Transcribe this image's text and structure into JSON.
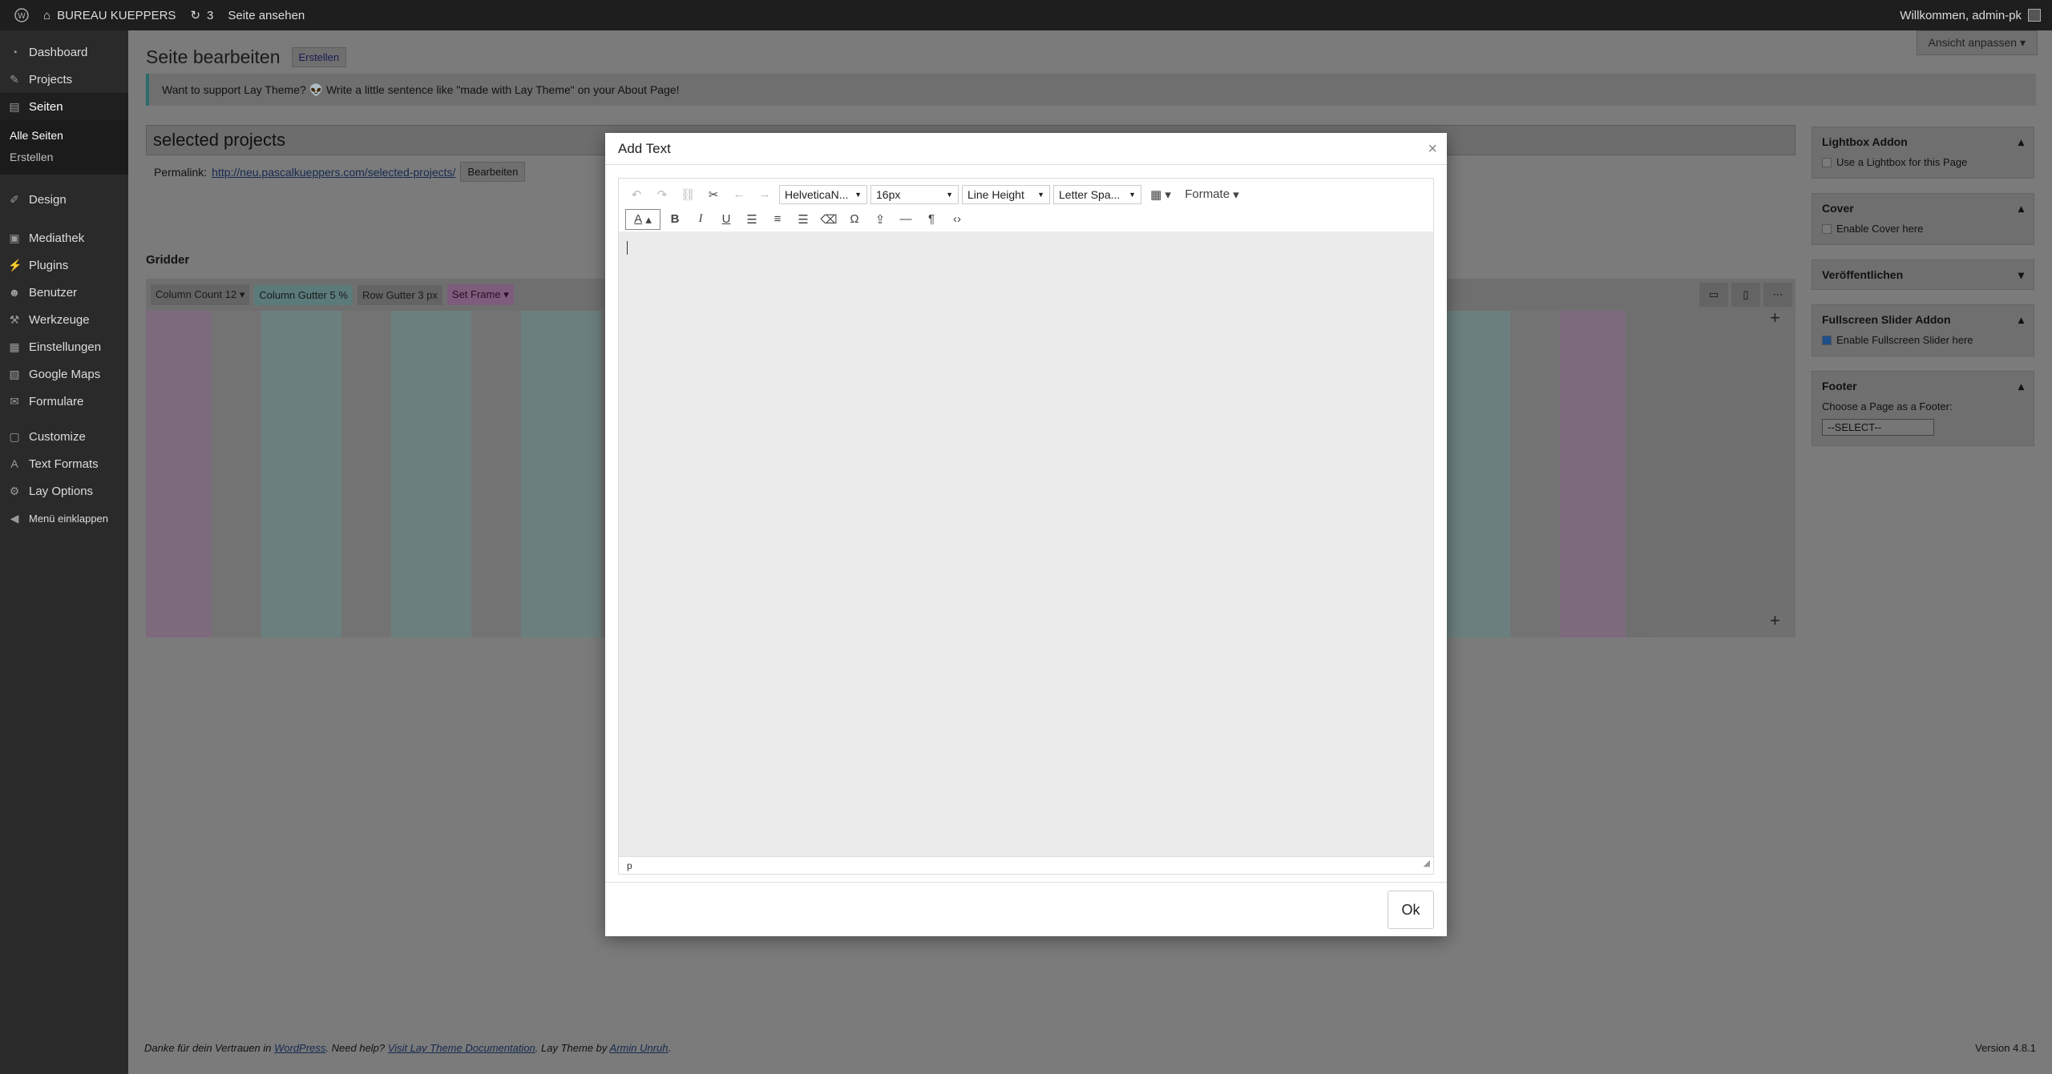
{
  "adminbar": {
    "site_name": "BUREAU KUEPPERS",
    "updates_count": "3",
    "view_page": "Seite ansehen",
    "greeting": "Willkommen, admin-pk"
  },
  "sidebar": {
    "items": [
      {
        "label": "Dashboard",
        "icon": "dashboard-icon"
      },
      {
        "label": "Projects",
        "icon": "pin-icon"
      },
      {
        "label": "Seiten",
        "icon": "pages-icon"
      },
      {
        "label": "Design",
        "icon": "brush-icon"
      },
      {
        "label": "Mediathek",
        "icon": "media-icon"
      },
      {
        "label": "Plugins",
        "icon": "plug-icon"
      },
      {
        "label": "Benutzer",
        "icon": "user-icon"
      },
      {
        "label": "Werkzeuge",
        "icon": "wrench-icon"
      },
      {
        "label": "Einstellungen",
        "icon": "settings-icon"
      },
      {
        "label": "Google Maps",
        "icon": "map-icon"
      },
      {
        "label": "Formulare",
        "icon": "mail-icon"
      },
      {
        "label": "Customize",
        "icon": "customize-icon"
      },
      {
        "label": "Text Formats",
        "icon": "text-icon"
      },
      {
        "label": "Lay Options",
        "icon": "gear-icon"
      },
      {
        "label": "Menü einklappen",
        "icon": "collapse-icon"
      }
    ],
    "sub_all": "Alle Seiten",
    "sub_create": "Erstellen"
  },
  "main": {
    "title": "Seite bearbeiten",
    "create_button": "Erstellen",
    "screen_options": "Ansicht anpassen",
    "notice": "Want to support Lay Theme? 👽 Write a little sentence like \"made with Lay Theme\" on your About Page!",
    "page_title_value": "selected projects",
    "permalink_label": "Permalink:",
    "permalink_url": "http://neu.pascalkueppers.com/selected-projects/",
    "permalink_edit": "Bearbeiten",
    "gridder_label": "Gridder",
    "gridder": {
      "column_count_label": "Column Count",
      "column_count_value": "12",
      "column_gutter_label": "Column Gutter",
      "column_gutter_value": "5",
      "column_gutter_unit": "%",
      "row_gutter_label": "Row Gutter",
      "row_gutter_value": "3",
      "row_gutter_unit": "px",
      "set_frame": "Set Frame"
    }
  },
  "meta": {
    "lightbox_title": "Lightbox Addon",
    "lightbox_option": "Use a Lightbox for this Page",
    "cover_title": "Cover",
    "cover_option": "Enable Cover here",
    "publish_title": "Veröffentlichen",
    "slider_title": "Fullscreen Slider Addon",
    "slider_option": "Enable Fullscreen Slider here",
    "footer_title": "Footer",
    "footer_choose": "Choose a Page as a Footer:",
    "footer_select": "--SELECT--"
  },
  "footer": {
    "thanks_pre": "Danke für dein Vertrauen in ",
    "wordpress": "WordPress",
    "need_help": ". Need help? ",
    "docs": "Visit Lay Theme Documentation",
    "lay_by": ". Lay Theme by ",
    "author": "Armin Unruh",
    "end": ".",
    "version": "Version 4.8.1"
  },
  "modal": {
    "title": "Add Text",
    "close": "×",
    "font_family": "HelveticaN...",
    "font_size": "16px",
    "line_height": "Line Height",
    "letter_spacing": "Letter Spa...",
    "formats": "Formate",
    "status_path": "p",
    "ok": "Ok"
  }
}
